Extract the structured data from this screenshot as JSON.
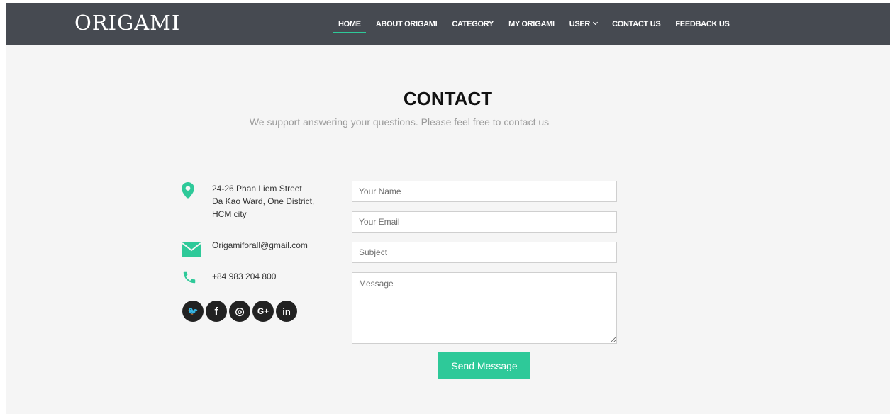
{
  "brand": "ORIGAMI",
  "nav": {
    "items": [
      {
        "label": "HOME"
      },
      {
        "label": "ABOUT ORIGAMI"
      },
      {
        "label": "CATEGORY"
      },
      {
        "label": "MY ORIGAMI"
      },
      {
        "label": "USER"
      },
      {
        "label": "CONTACT US"
      },
      {
        "label": "FEEDBACK US"
      }
    ],
    "active_item": "HOME"
  },
  "contact": {
    "title": "CONTACT",
    "subtitle": "We support answering your questions. Please feel free to contact us",
    "address": [
      "24-26 Phan Liem Street",
      "Da Kao Ward, One District,",
      "HCM city"
    ],
    "email": "Origamiforall@gmail.com",
    "phone": "+84 983 204 800"
  },
  "social": [
    {
      "icon": "twitter-icon",
      "glyph": "🐦"
    },
    {
      "icon": "facebook-icon",
      "glyph": "f"
    },
    {
      "icon": "instagram-icon",
      "glyph": "◎"
    },
    {
      "icon": "google-plus-icon",
      "glyph": "G+"
    },
    {
      "icon": "linkedin-icon",
      "glyph": "in"
    }
  ],
  "form": {
    "name_placeholder": "Your Name",
    "email_placeholder": "Your Email",
    "subject_placeholder": "Subject",
    "message_placeholder": "Message",
    "submit_label": "Send Message"
  },
  "colors": {
    "navbar": "#464a51",
    "accent": "#2ec999",
    "page_background": "#f5f5f5"
  }
}
